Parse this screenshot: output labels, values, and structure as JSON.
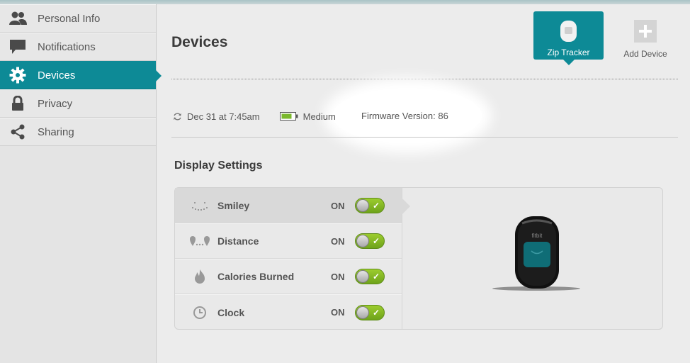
{
  "sidebar": {
    "items": [
      {
        "label": "Personal Info",
        "icon": "people-icon"
      },
      {
        "label": "Notifications",
        "icon": "speech-bubble-icon"
      },
      {
        "label": "Devices",
        "icon": "gear-icon",
        "active": true
      },
      {
        "label": "Privacy",
        "icon": "lock-icon"
      },
      {
        "label": "Sharing",
        "icon": "share-icon"
      }
    ]
  },
  "header": {
    "title": "Devices",
    "tracker_label": "Zip Tracker",
    "add_device_label": "Add Device"
  },
  "status": {
    "last_sync": "Dec 31 at 7:45am",
    "battery": "Medium",
    "firmware": "Firmware Version: 86"
  },
  "display_settings": {
    "title": "Display Settings",
    "rows": [
      {
        "label": "Smiley",
        "state": "ON",
        "icon": "smiley-icon"
      },
      {
        "label": "Distance",
        "state": "ON",
        "icon": "distance-icon"
      },
      {
        "label": "Calories Burned",
        "state": "ON",
        "icon": "flame-icon"
      },
      {
        "label": "Clock",
        "state": "ON",
        "icon": "clock-icon"
      }
    ]
  },
  "device_preview": {
    "brand": "fitbit"
  },
  "colors": {
    "accent": "#0d8a96",
    "toggle_on": "#8bc12a"
  }
}
